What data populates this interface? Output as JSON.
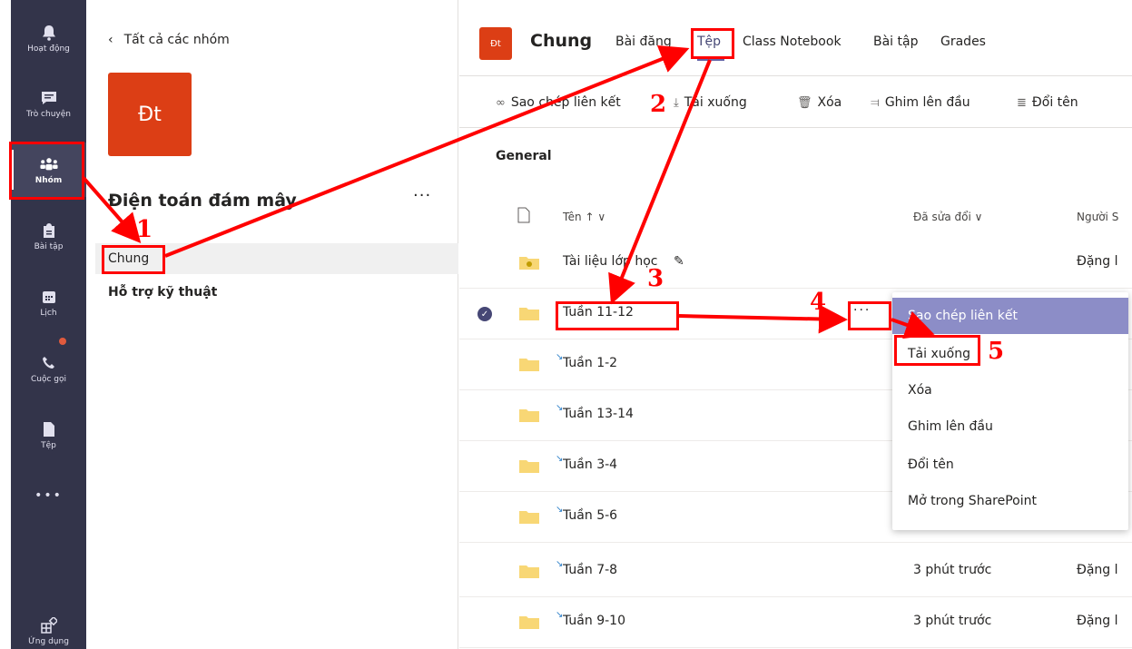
{
  "rail": {
    "items": [
      {
        "label": "Hoạt động",
        "icon": "bell-icon"
      },
      {
        "label": "Trò chuyện",
        "icon": "chat-icon"
      },
      {
        "label": "Nhóm",
        "icon": "teams-icon"
      },
      {
        "label": "Bài tập",
        "icon": "assignments-icon"
      },
      {
        "label": "Lịch",
        "icon": "calendar-icon"
      },
      {
        "label": "Cuộc gọi",
        "icon": "phone-icon"
      },
      {
        "label": "Tệp",
        "icon": "file-icon"
      },
      {
        "label": "•••",
        "icon": "more-icon"
      },
      {
        "label": "Ứng dụng",
        "icon": "apps-icon"
      }
    ]
  },
  "team_panel": {
    "back_label": "Tất cả các nhóm",
    "avatar": "Đt",
    "team_name": "Điện toán đám mây",
    "more": "···",
    "channels": [
      "Chung",
      "Hỗ trợ kỹ thuật"
    ]
  },
  "header": {
    "avatar": "Đt",
    "title": "Chung",
    "tabs": [
      "Bài đăng",
      "Tệp",
      "Class Notebook",
      "Bài tập",
      "Grades"
    ]
  },
  "toolbar": {
    "copy_link": "Sao chép liên kết",
    "download": "Tải xuống",
    "delete": "Xóa",
    "pin": "Ghim lên đầu",
    "rename": "Đổi tên"
  },
  "files": {
    "section": "General",
    "col_name": "Tên ↑ ∨",
    "col_modified": "Đã sửa đổi ∨",
    "col_by": "Người S",
    "rows": [
      {
        "name": "Tài liệu lớp học",
        "modified": "",
        "by": "Đặng l"
      },
      {
        "name": "Tuần 11-12",
        "modified": "",
        "by": ""
      },
      {
        "name": "Tuần 1-2",
        "modified": "",
        "by": ""
      },
      {
        "name": "Tuần 13-14",
        "modified": "",
        "by": ""
      },
      {
        "name": "Tuần 3-4",
        "modified": "",
        "by": ""
      },
      {
        "name": "Tuần 5-6",
        "modified": "",
        "by": ""
      },
      {
        "name": "Tuần 7-8",
        "modified": "3 phút trước",
        "by": "Đặng l"
      },
      {
        "name": "Tuần 9-10",
        "modified": "3 phút trước",
        "by": "Đặng l"
      }
    ],
    "row_more": "···"
  },
  "context_menu": {
    "items": [
      "Sao chép liên kết",
      "Tải xuống",
      "Xóa",
      "Ghim lên đầu",
      "Đổi tên",
      "Mở trong SharePoint"
    ]
  },
  "annotations": {
    "steps": [
      "1",
      "2",
      "3",
      "4",
      "5"
    ],
    "color": "#ff0000"
  },
  "colors": {
    "rail": "#33344a",
    "accent": "#6264a7",
    "team_avatar": "#dc3e15",
    "menu_highlight": "#8c8dc7"
  }
}
